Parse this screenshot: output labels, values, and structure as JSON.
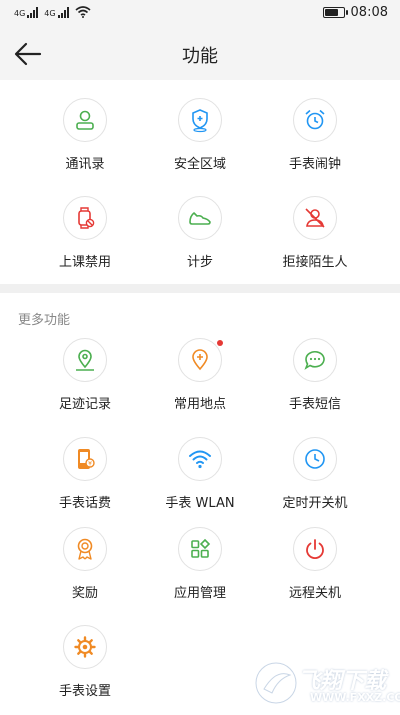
{
  "status_bar": {
    "time": "08:08",
    "signal_label": "4G",
    "battery_level": 0.85
  },
  "header": {
    "title": "功能",
    "back_icon": "back-arrow-icon"
  },
  "main_functions": [
    {
      "label": "通讯录",
      "icon": "contacts-icon",
      "color": "#4caf50"
    },
    {
      "label": "安全区域",
      "icon": "safe-zone-icon",
      "color": "#2196f3"
    },
    {
      "label": "手表闹钟",
      "icon": "alarm-clock-icon",
      "color": "#2196f3"
    },
    {
      "label": "上课禁用",
      "icon": "class-disable-icon",
      "color": "#e53935"
    },
    {
      "label": "计步",
      "icon": "step-shoe-icon",
      "color": "#4caf50"
    },
    {
      "label": "拒接陌生人",
      "icon": "reject-stranger-icon",
      "color": "#e53935"
    }
  ],
  "more_functions": {
    "title": "更多功能",
    "items": [
      {
        "label": "足迹记录",
        "icon": "footprint-icon",
        "color": "#4caf50"
      },
      {
        "label": "常用地点",
        "icon": "favorite-place-icon",
        "color": "#f08a24",
        "badge": true
      },
      {
        "label": "手表短信",
        "icon": "sms-icon",
        "color": "#4caf50"
      },
      {
        "label": "手表话费",
        "icon": "phone-bill-icon",
        "color": "#f08a24"
      },
      {
        "label": "手表 WLAN",
        "icon": "wlan-icon",
        "color": "#2196f3"
      },
      {
        "label": "定时开关机",
        "icon": "timer-power-icon",
        "color": "#2196f3"
      },
      {
        "label": "奖励",
        "icon": "award-icon",
        "color": "#f08a24"
      },
      {
        "label": "应用管理",
        "icon": "app-manage-icon",
        "color": "#4caf50"
      },
      {
        "label": "远程关机",
        "icon": "remote-shutdown-icon",
        "color": "#e53935"
      },
      {
        "label": "手表设置",
        "icon": "settings-gear-icon",
        "color": "#f08a24"
      }
    ]
  },
  "watermark": {
    "text": "飞翔下载",
    "url_text": "WWW.FXXZ.COM"
  }
}
